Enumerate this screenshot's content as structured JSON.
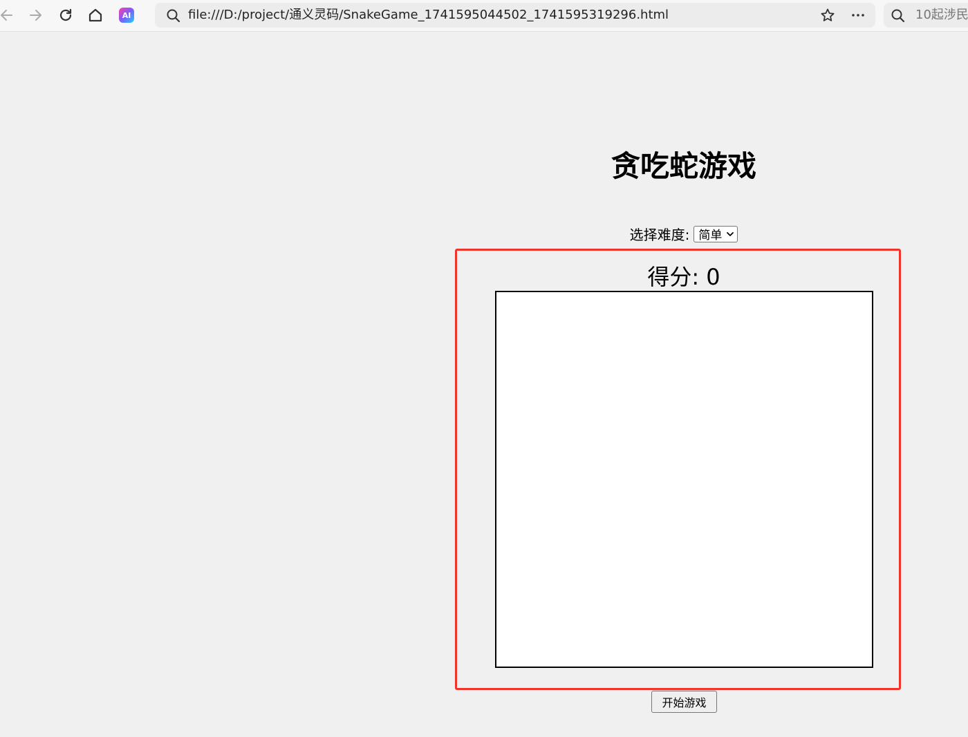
{
  "browser": {
    "url": "file:///D:/project/通义灵码/SnakeGame_1741595044502_1741595319296.html",
    "ai_label": "AI",
    "side_search_text": "10起涉民"
  },
  "game": {
    "title": "贪吃蛇游戏",
    "difficulty_label": "选择难度:",
    "difficulty_selected": "简单",
    "score_label": "得分: 0",
    "start_button_label": "开始游戏"
  },
  "colors": {
    "highlight": "#f2332b",
    "page_background": "#f0f0f0"
  }
}
